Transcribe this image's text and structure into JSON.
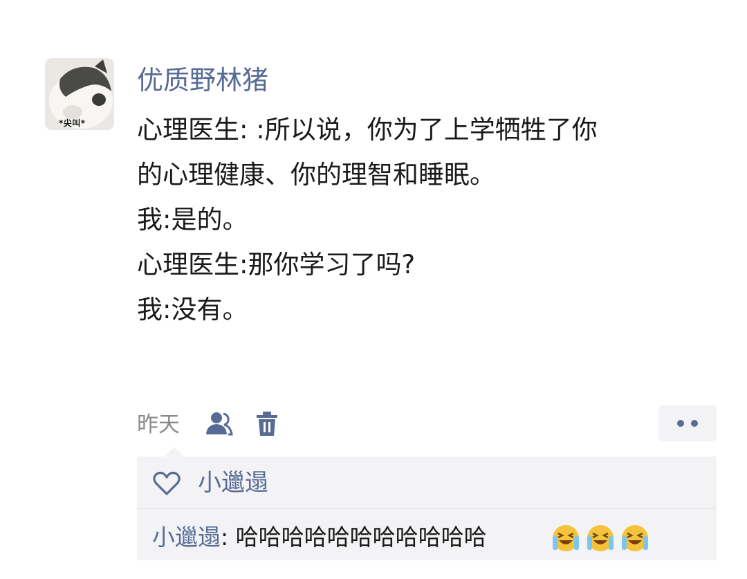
{
  "post": {
    "avatar": {
      "caption": "*尖叫*",
      "icon": "cat-avatar"
    },
    "username": "优质野林猪",
    "lines": [
      "心理医生: :所以说，你为了上学牺牲了你",
      "的心理健康、你的理智和睡眠。",
      "我:是的。",
      "心理医生:那你学习了吗?",
      "我:没有。"
    ]
  },
  "meta": {
    "time": "昨天",
    "privacy_icon": "people-icon",
    "delete_icon": "trash-icon",
    "more_icon": "two-dots-icon"
  },
  "interactions": {
    "like_icon": "heart-outline-icon",
    "likes": [
      "小邋遢"
    ],
    "comments": [
      {
        "author": "小邋遢",
        "separator": ": ",
        "text": "哈哈哈哈哈哈哈哈哈哈哈",
        "emoji": [
          "crying-laughing-emoji",
          "crying-laughing-emoji",
          "crying-laughing-emoji"
        ]
      }
    ]
  },
  "colors": {
    "link": "#576b95",
    "text": "#1a1a1a",
    "meta": "#8a8a8a",
    "panel": "#f3f3f5"
  }
}
